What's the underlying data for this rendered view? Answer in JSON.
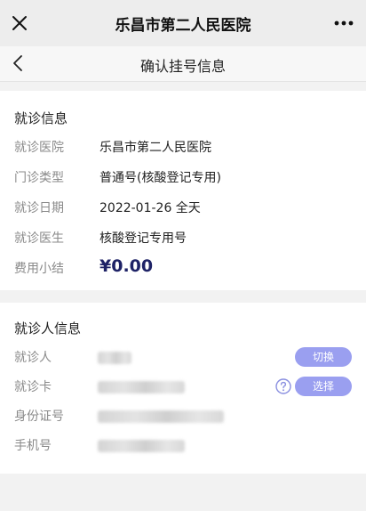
{
  "wx_header": {
    "title": "乐昌市第二人民医院"
  },
  "nav": {
    "title": "确认挂号信息"
  },
  "visit_info": {
    "title": "就诊信息",
    "rows": [
      {
        "label": "就诊医院",
        "value": "乐昌市第二人民医院"
      },
      {
        "label": "门诊类型",
        "value": "普通号(核酸登记专用)"
      },
      {
        "label": "就诊日期",
        "value": "2022-01-26 全天"
      },
      {
        "label": "就诊医生",
        "value": "核酸登记专用号"
      },
      {
        "label": "费用小结",
        "value": "¥0.00"
      }
    ]
  },
  "patient_info": {
    "title": "就诊人信息",
    "rows": [
      {
        "label": "就诊人",
        "action": "切换"
      },
      {
        "label": "就诊卡",
        "action": "选择"
      },
      {
        "label": "身份证号"
      },
      {
        "label": "手机号"
      }
    ]
  },
  "colors": {
    "accent": "#9a9ff0",
    "price": "#1e2266",
    "label": "#8a8a8a"
  }
}
